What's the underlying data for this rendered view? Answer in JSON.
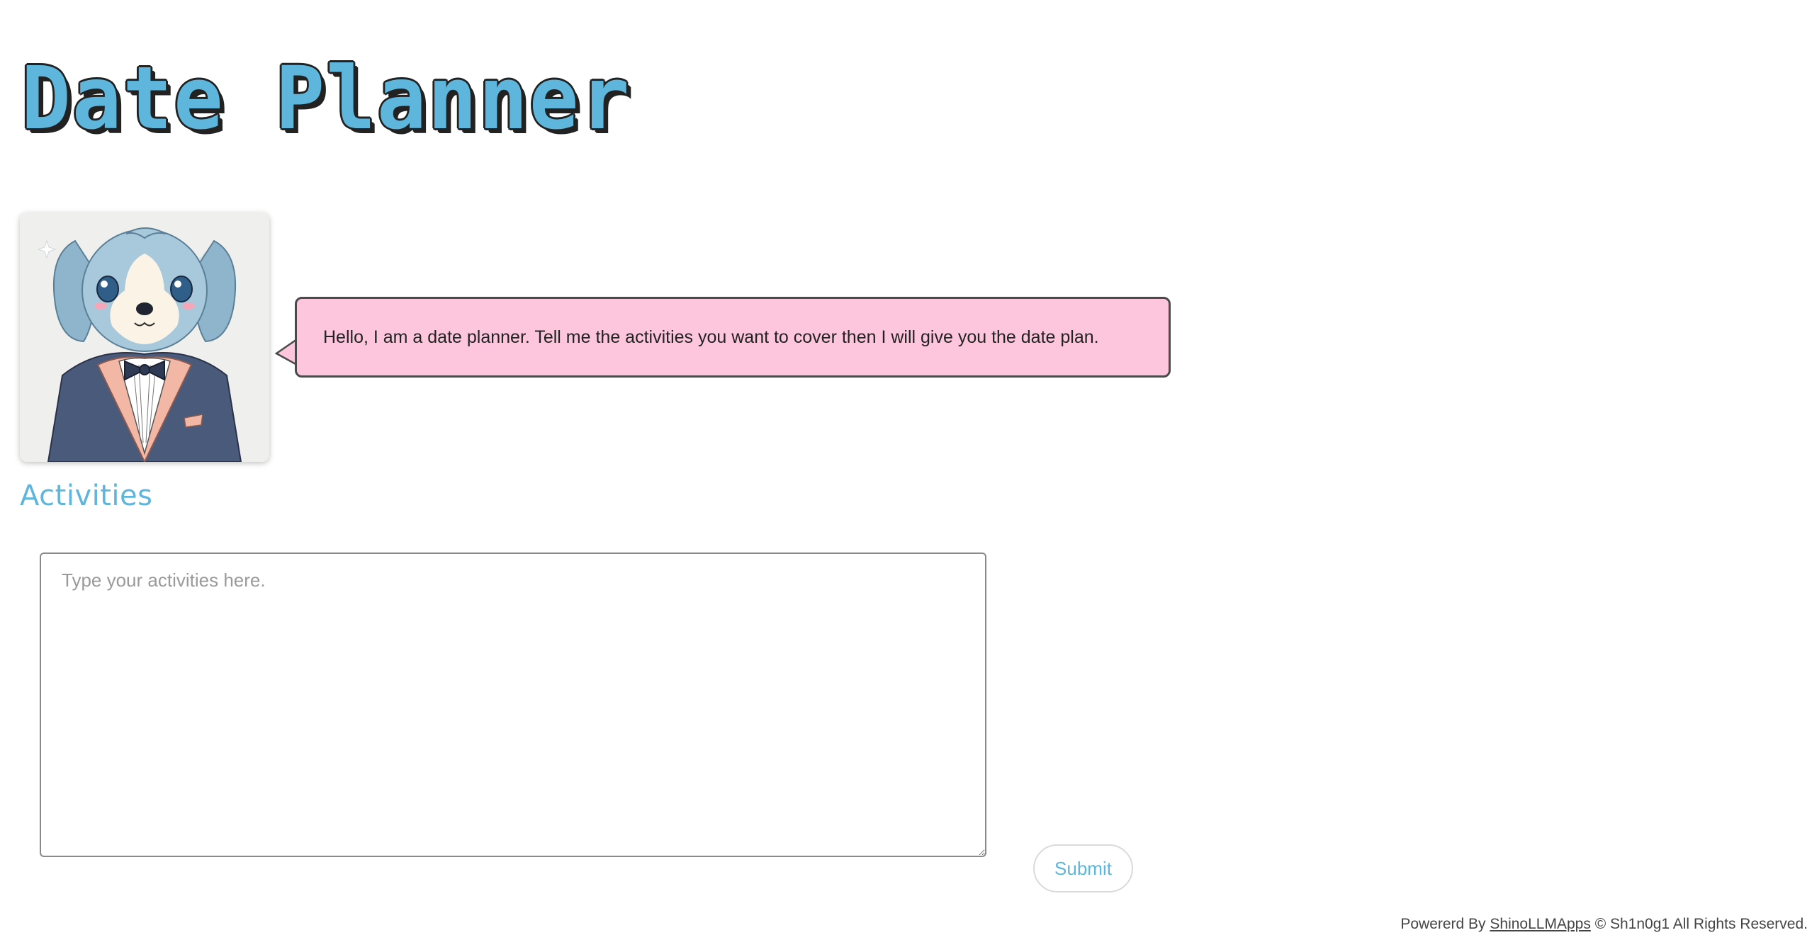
{
  "header": {
    "title": "Date Planner"
  },
  "assistant": {
    "avatar_icon": "dog-butler-avatar",
    "greeting": "Hello, I am a date planner. Tell me the activities you want to cover then I will give you the date plan.",
    "bubble_color": "#fdc6dc"
  },
  "form": {
    "section_label": "Activities",
    "input_placeholder": "Type your activities here.",
    "input_value": "",
    "submit_label": "Submit"
  },
  "footer": {
    "prefix": "Powererd By",
    "link_label": "ShinoLLMApps",
    "suffix": "© Sh1n0g1 All Rights Reserved."
  },
  "colors": {
    "accent": "#5fb6dc",
    "text": "#222222"
  }
}
